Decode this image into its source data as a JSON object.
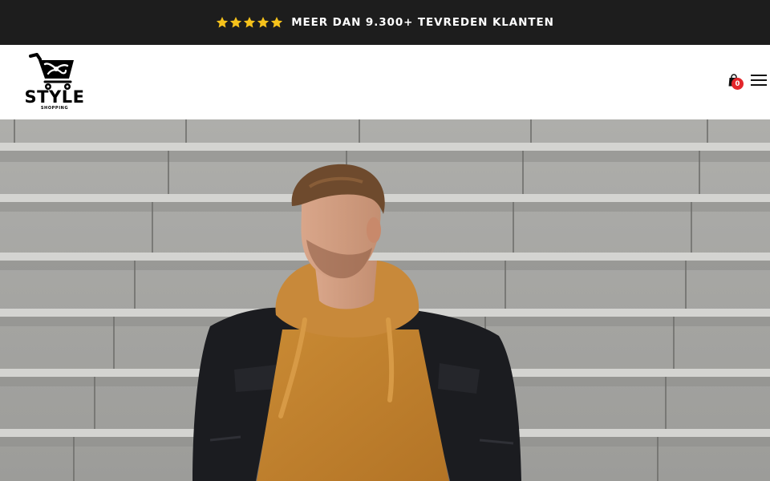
{
  "announcement": {
    "rating_stars": 5,
    "text": "MEER DAN 9.300+ TEVREDEN KLANTEN",
    "star_color": "#f6c21b",
    "background": "#1d1d1d"
  },
  "header": {
    "logo": {
      "word": "STYLE",
      "sub": "SHOPPING"
    },
    "cart": {
      "icon": "shopping-bag-icon",
      "count": "0",
      "badge_color": "#e3262b"
    },
    "menu": {
      "icon": "hamburger-menu-icon"
    }
  },
  "hero": {
    "image": "man-in-orange-hoodie-and-black-jacket-on-concrete-stairs"
  }
}
